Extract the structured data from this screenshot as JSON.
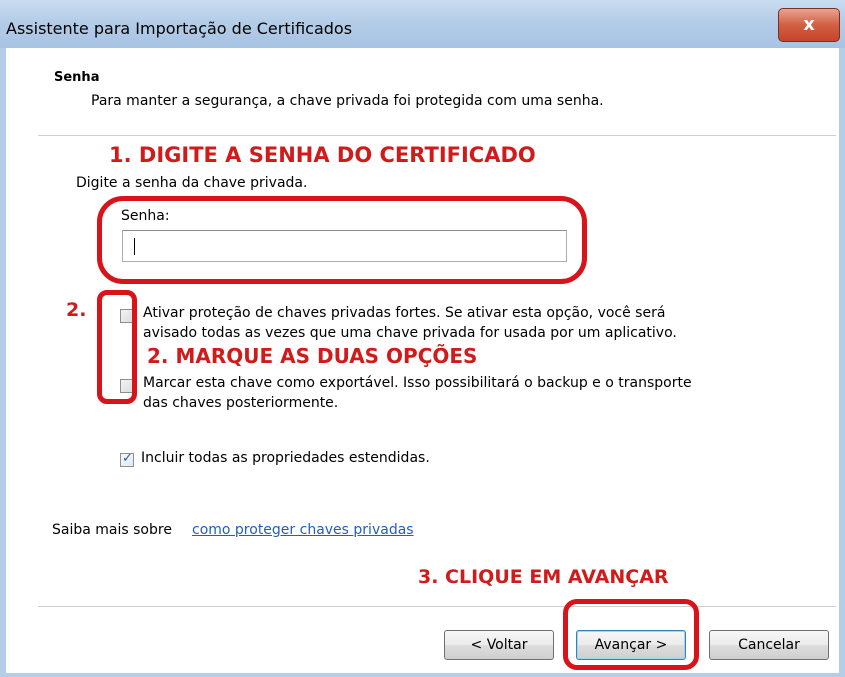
{
  "window": {
    "title": "Assistente para Importação de Certificados",
    "close_label": "x"
  },
  "header": {
    "section_title": "Senha",
    "description": "Para manter a segurança, a chave privada foi protegida com uma senha."
  },
  "annotations": {
    "step1": "1. DIGITE A SENHA DO CERTIFICADO",
    "step2_number": "2.",
    "step2": "2. MARQUE AS DUAS OPÇÕES",
    "step3": "3. CLIQUE EM AVANÇAR",
    "color": "#d11a1a"
  },
  "form": {
    "instruction": "Digite a senha da chave privada.",
    "password_label": "Senha:",
    "password_value": "",
    "options": [
      {
        "line1": "Ativar proteção de chaves privadas fortes. Se ativar esta opção, você será",
        "line2": "avisado todas as vezes que uma chave privada for usada por um aplicativo.",
        "checked": false
      },
      {
        "line1": "Marcar esta chave como exportável. Isso possibilitará o backup e o transporte",
        "line2": "das chaves posteriormente.",
        "checked": false
      },
      {
        "line1": "Incluir todas as propriedades estendidas.",
        "line2": "",
        "checked": true
      }
    ]
  },
  "footer": {
    "learn_more_prefix": "Saiba mais sobre",
    "learn_more_link": "como proteger chaves privadas",
    "buttons": {
      "back": "< Voltar",
      "next": "Avançar >",
      "cancel": "Cancelar"
    }
  }
}
